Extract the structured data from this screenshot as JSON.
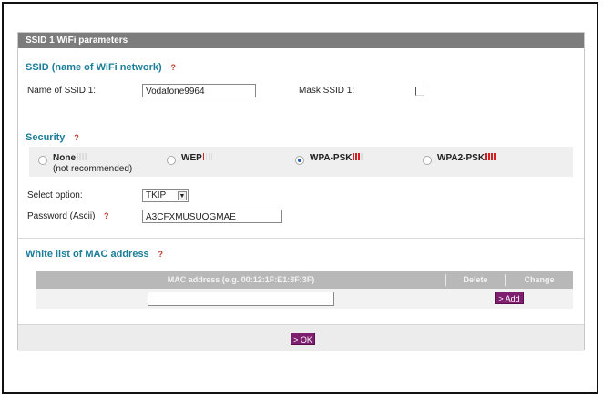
{
  "panel": {
    "title": "SSID 1 WiFi parameters"
  },
  "ssid": {
    "section_title": "SSID (name of WiFi network)",
    "name_label": "Name of SSID 1:",
    "name_value": "Vodafone9964",
    "mask_label": "Mask SSID 1:",
    "mask_checked": false
  },
  "security": {
    "section_title": "Security",
    "options": [
      {
        "label": "None",
        "sub": "(not recommended)",
        "selected": false,
        "strength": 0
      },
      {
        "label": "WEP",
        "sub": "",
        "selected": false,
        "strength": 1
      },
      {
        "label": "WPA-PSK",
        "sub": "",
        "selected": true,
        "strength": 3
      },
      {
        "label": "WPA2-PSK",
        "sub": "",
        "selected": false,
        "strength": 4
      }
    ],
    "select_option_label": "Select option:",
    "select_option_value": "TKIP",
    "password_label": "Password (Ascii)",
    "password_value": "A3CFXMUSUOGMAE"
  },
  "mac": {
    "section_title": "White list of MAC address",
    "columns": [
      "MAC address (e.g. 00:12:1F:E1:3F:3F)",
      "Delete",
      "Change"
    ],
    "input_value": "",
    "add_label": "> Add"
  },
  "footer": {
    "ok_label": "> OK"
  },
  "help_glyph": "?",
  "colors": {
    "section_title": "#1b7d9a",
    "button": "#7d1e6e",
    "header": "#7c7c7c",
    "strength_red": "#d62020"
  }
}
